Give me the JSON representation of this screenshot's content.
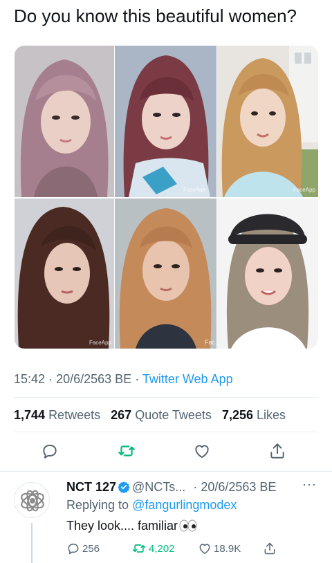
{
  "tweet": {
    "text": "Do you know this beautiful women?",
    "photos": [
      {
        "watermark": ""
      },
      {
        "watermark": "FaceApp"
      },
      {
        "watermark": "FaceApp"
      },
      {
        "watermark": "FaceApp"
      },
      {
        "watermark": "Fac"
      },
      {
        "watermark": ""
      }
    ],
    "time": "15:42",
    "date": "20/6/2563 BE",
    "source": "Twitter Web App",
    "retweets_count": "1,744",
    "retweets_label": "Retweets",
    "quote_count": "267",
    "quote_label": "Quote Tweets",
    "likes_count": "7,256",
    "likes_label": "Likes"
  },
  "colors": {
    "accent": "#1d9bf0",
    "retweet_green": "#00ba7c",
    "secondary_text": "#536471",
    "primary_text": "#0f1419"
  },
  "reply": {
    "name": "NCT 127",
    "handle": "@NCTs...",
    "date": "· 20/6/2563 BE",
    "more": "···",
    "replying_prefix": "Replying to",
    "replying_handle": "@fangurlingmodex",
    "text": "They look.... familiar",
    "replies": "256",
    "retweets": "4,202",
    "likes": "18.9K"
  },
  "icons": [
    "reply-icon",
    "retweet-icon",
    "like-icon",
    "share-icon",
    "verified-icon",
    "eyes-emoji",
    "more-icon"
  ]
}
